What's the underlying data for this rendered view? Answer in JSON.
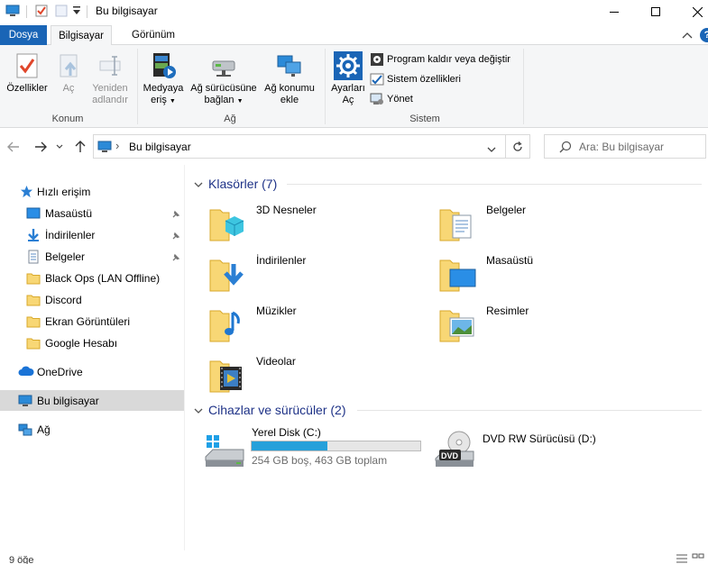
{
  "window": {
    "title": "Bu bilgisayar"
  },
  "ribbon": {
    "tabs": {
      "file": "Dosya",
      "computer": "Bilgisayar",
      "view": "Görünüm"
    },
    "location_group": {
      "label": "Konum",
      "properties": "Özellikler",
      "open": "Aç",
      "rename_line1": "Yeniden",
      "rename_line2": "adlandır"
    },
    "network_group": {
      "label": "Ağ",
      "media_line1": "Medyaya",
      "media_line2": "eriş",
      "map_drive_line1": "Ağ sürücüsüne",
      "map_drive_line2": "bağlan",
      "add_location_line1": "Ağ konumu",
      "add_location_line2": "ekle"
    },
    "system_group": {
      "label": "Sistem",
      "settings_line1": "Ayarları",
      "settings_line2": "Aç",
      "uninstall": "Program kaldır veya değiştir",
      "system_properties": "Sistem özellikleri",
      "manage": "Yönet"
    },
    "help_glyph": "?"
  },
  "address": {
    "path_separator": "›",
    "path": "Bu bilgisayar",
    "search_placeholder": "Ara: Bu bilgisayar"
  },
  "nav_pane": {
    "quick_access": "Hızlı erişim",
    "items": [
      {
        "label": "Masaüstü",
        "pinned": true
      },
      {
        "label": "İndirilenler",
        "pinned": true
      },
      {
        "label": "Belgeler",
        "pinned": true
      },
      {
        "label": "Black Ops (LAN Offline)",
        "pinned": false
      },
      {
        "label": "Discord",
        "pinned": false
      },
      {
        "label": "Ekran Görüntüleri",
        "pinned": false
      },
      {
        "label": "Google Hesabı",
        "pinned": false
      }
    ],
    "onedrive": "OneDrive",
    "this_pc": "Bu bilgisayar",
    "network": "Ağ"
  },
  "content": {
    "folders_header": "Klasörler (7)",
    "folders": [
      {
        "label": "3D Nesneler",
        "icon": "3d-objects-icon"
      },
      {
        "label": "Belgeler",
        "icon": "documents-icon"
      },
      {
        "label": "İndirilenler",
        "icon": "downloads-icon"
      },
      {
        "label": "Masaüstü",
        "icon": "desktop-icon"
      },
      {
        "label": "Müzikler",
        "icon": "music-icon"
      },
      {
        "label": "Resimler",
        "icon": "pictures-icon"
      },
      {
        "label": "Videolar",
        "icon": "videos-icon"
      }
    ],
    "drives_header": "Cihazlar ve sürücüler (2)",
    "drives": {
      "local": {
        "label": "Yerel Disk (C:)",
        "free_text": "254 GB boş, 463 GB toplam",
        "used_fraction": 0.45
      },
      "dvd": {
        "label": "DVD RW Sürücüsü (D:)",
        "badge": "DVD"
      }
    }
  },
  "status": {
    "item_count": "9 öğe"
  },
  "colors": {
    "accent": "#1a65b6",
    "header_text": "#1e3287",
    "progress": "#26a0da",
    "folder": "#f8d775"
  }
}
